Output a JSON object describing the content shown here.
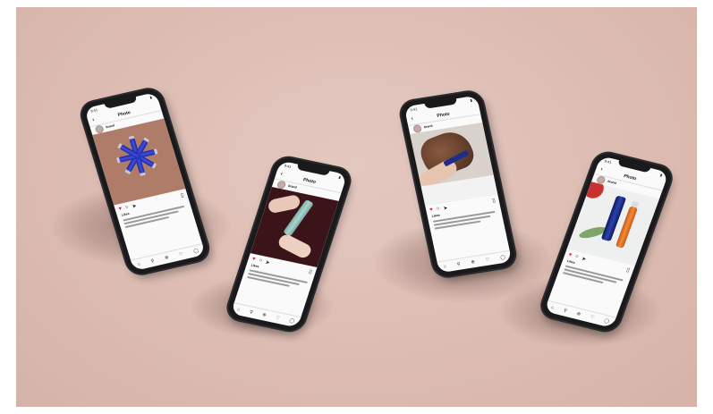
{
  "scene": {
    "background_color": "#dcbbb1",
    "description_phones": 4
  },
  "phones": [
    {
      "screen_title": "Photo",
      "status_time": "9:41",
      "username": "brand",
      "likes": "Likes",
      "photo_colors": {
        "bg": "#b07c6a",
        "product": "#2a35c4"
      }
    },
    {
      "screen_title": "Photo",
      "status_time": "9:41",
      "username": "brand",
      "likes": "Likes",
      "photo_colors": {
        "bg": "#3a1418",
        "product": "#8fbcb5"
      }
    },
    {
      "screen_title": "Photo",
      "status_time": "9:41",
      "username": "brand",
      "likes": "Likes",
      "photo_colors": {
        "bg": "#d9d2cc",
        "product": "#5a3a2a"
      }
    },
    {
      "screen_title": "Photo",
      "status_time": "9:41",
      "username": "brand",
      "likes": "Likes",
      "photo_colors": {
        "bg": "#eef0f0",
        "product": "#1d2e8a",
        "accent": "#e9722a"
      }
    }
  ],
  "icons": {
    "heart": "heart-icon",
    "comment": "comment-icon",
    "share": "share-icon",
    "bookmark": "bookmark-icon",
    "home": "home-icon",
    "search": "search-icon",
    "add": "add-icon",
    "activity": "heart-outline-icon",
    "profile": "profile-icon"
  }
}
